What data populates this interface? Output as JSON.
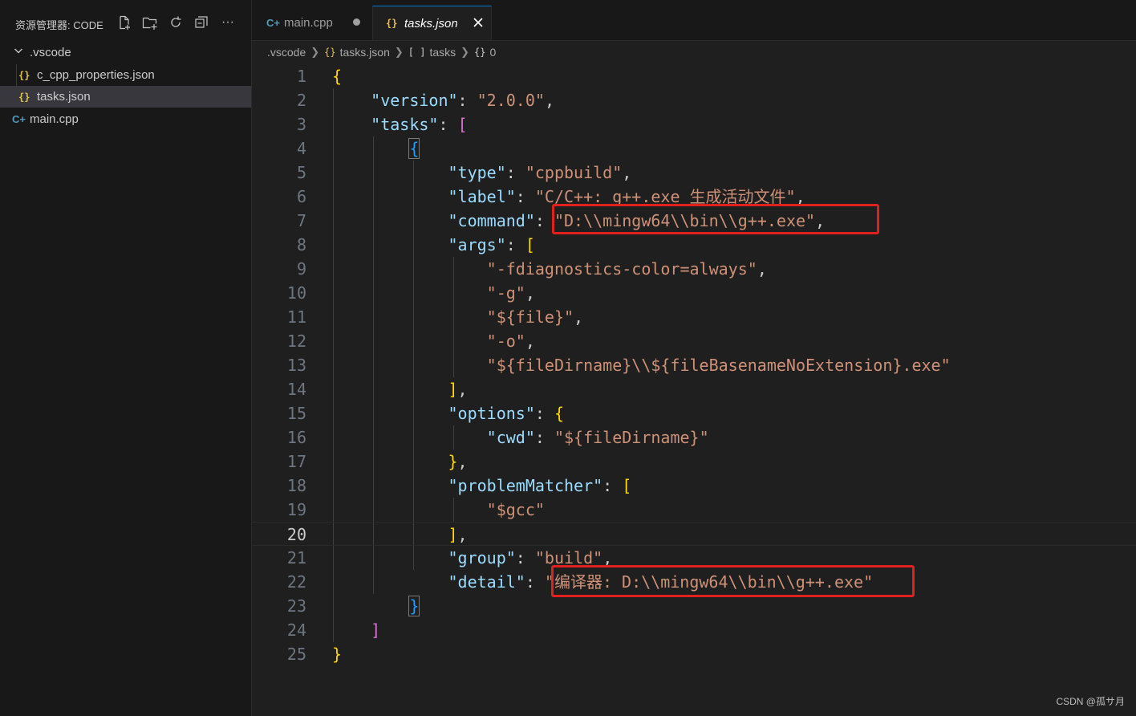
{
  "sidebar": {
    "title": "资源管理器: CODE",
    "folder": ".vscode",
    "items": [
      {
        "label": "c_cpp_properties.json",
        "icon": "{}"
      },
      {
        "label": "tasks.json",
        "icon": "{}"
      },
      {
        "label": "main.cpp",
        "icon": "C+"
      }
    ]
  },
  "tabs": [
    {
      "label": "main.cpp",
      "modified": true
    },
    {
      "label": "tasks.json",
      "active": true
    }
  ],
  "breadcrumb": [
    ".vscode",
    "tasks.json",
    "tasks",
    "0"
  ],
  "breadcrumb_icons": [
    "{}",
    "[ ]",
    "{}"
  ],
  "editor": {
    "current_line": 20,
    "lines": [
      "1",
      "2",
      "3",
      "4",
      "5",
      "6",
      "7",
      "8",
      "9",
      "10",
      "11",
      "12",
      "13",
      "14",
      "15",
      "16",
      "17",
      "18",
      "19",
      "20",
      "21",
      "22",
      "23",
      "24",
      "25"
    ],
    "tokens": {
      "version_key": "\"version\"",
      "version_val": "\"2.0.0\"",
      "tasks_key": "\"tasks\"",
      "type_key": "\"type\"",
      "type_val": "\"cppbuild\"",
      "label_key": "\"label\"",
      "label_val": "\"C/C++: g++.exe 生成活动文件\"",
      "command_key": "\"command\"",
      "command_val": "\"D:\\\\mingw64\\\\bin\\\\g++.exe\"",
      "args_key": "\"args\"",
      "arg1": "\"-fdiagnostics-color=always\"",
      "arg2": "\"-g\"",
      "arg3": "\"${file}\"",
      "arg4": "\"-o\"",
      "arg5": "\"${fileDirname}\\\\${fileBasenameNoExtension}.exe\"",
      "options_key": "\"options\"",
      "cwd_key": "\"cwd\"",
      "cwd_val": "\"${fileDirname}\"",
      "pm_key": "\"problemMatcher\"",
      "pm_val": "\"$gcc\"",
      "group_key": "\"group\"",
      "group_val": "\"build\"",
      "detail_key": "\"detail\"",
      "detail_val": "\"编译器: D:\\\\mingw64\\\\bin\\\\g++.exe\""
    }
  },
  "watermark": "CSDN @孤サ月",
  "colors": {
    "key": "#9cdcfe",
    "string": "#ce9178",
    "highlight": "#e0211d",
    "accent": "#0078d4"
  }
}
